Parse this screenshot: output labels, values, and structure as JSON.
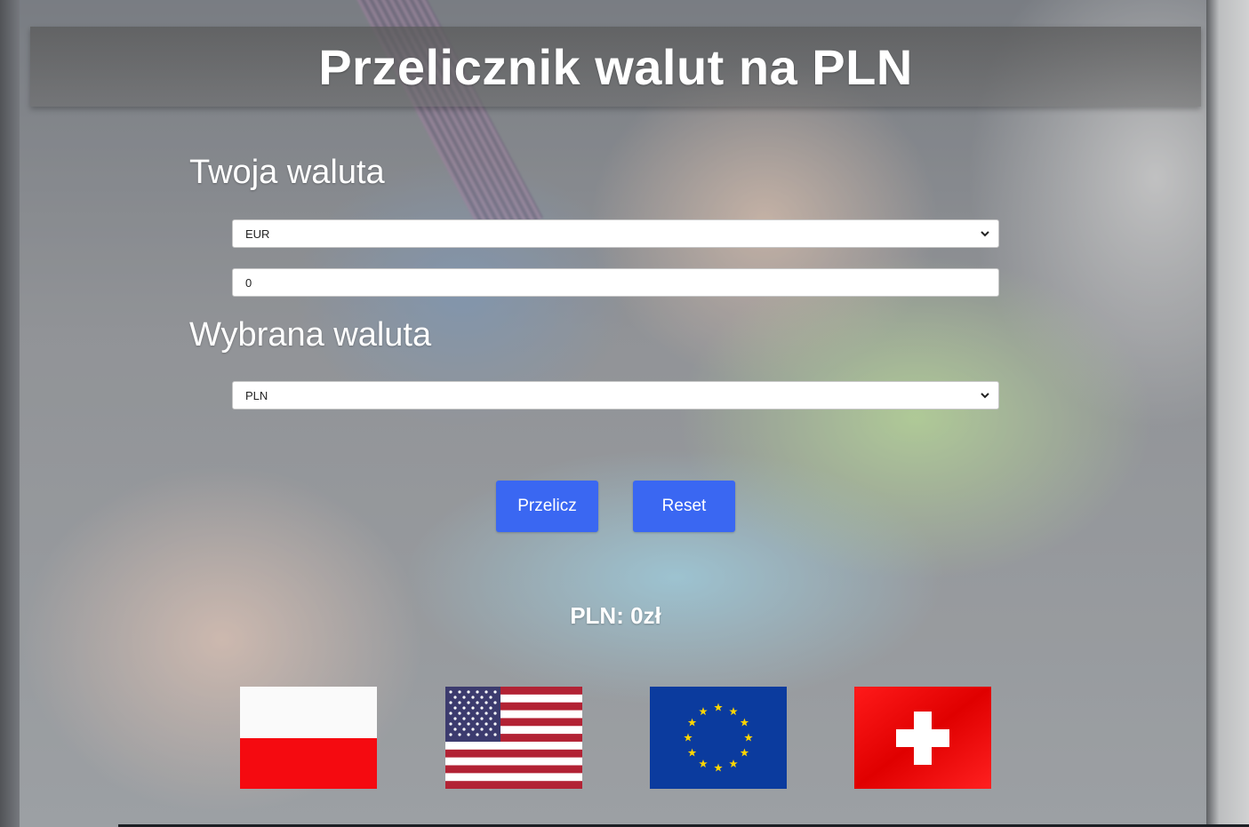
{
  "header": {
    "title": "Przelicznik walut na PLN"
  },
  "from_section": {
    "title": "Twoja waluta",
    "currency_select": {
      "selected": "EUR"
    },
    "amount_input": {
      "value": "0"
    }
  },
  "to_section": {
    "title": "Wybrana waluta",
    "currency_select": {
      "selected": "PLN"
    }
  },
  "buttons": {
    "convert": "Przelicz",
    "reset": "Reset"
  },
  "result": {
    "text": "PLN: 0zł"
  },
  "flags": [
    {
      "icon": "poland-flag-icon"
    },
    {
      "icon": "usa-flag-icon"
    },
    {
      "icon": "eu-flag-icon"
    },
    {
      "icon": "switzerland-flag-icon"
    }
  ],
  "colors": {
    "button": "#3a67f2",
    "text": "#ffffff"
  }
}
